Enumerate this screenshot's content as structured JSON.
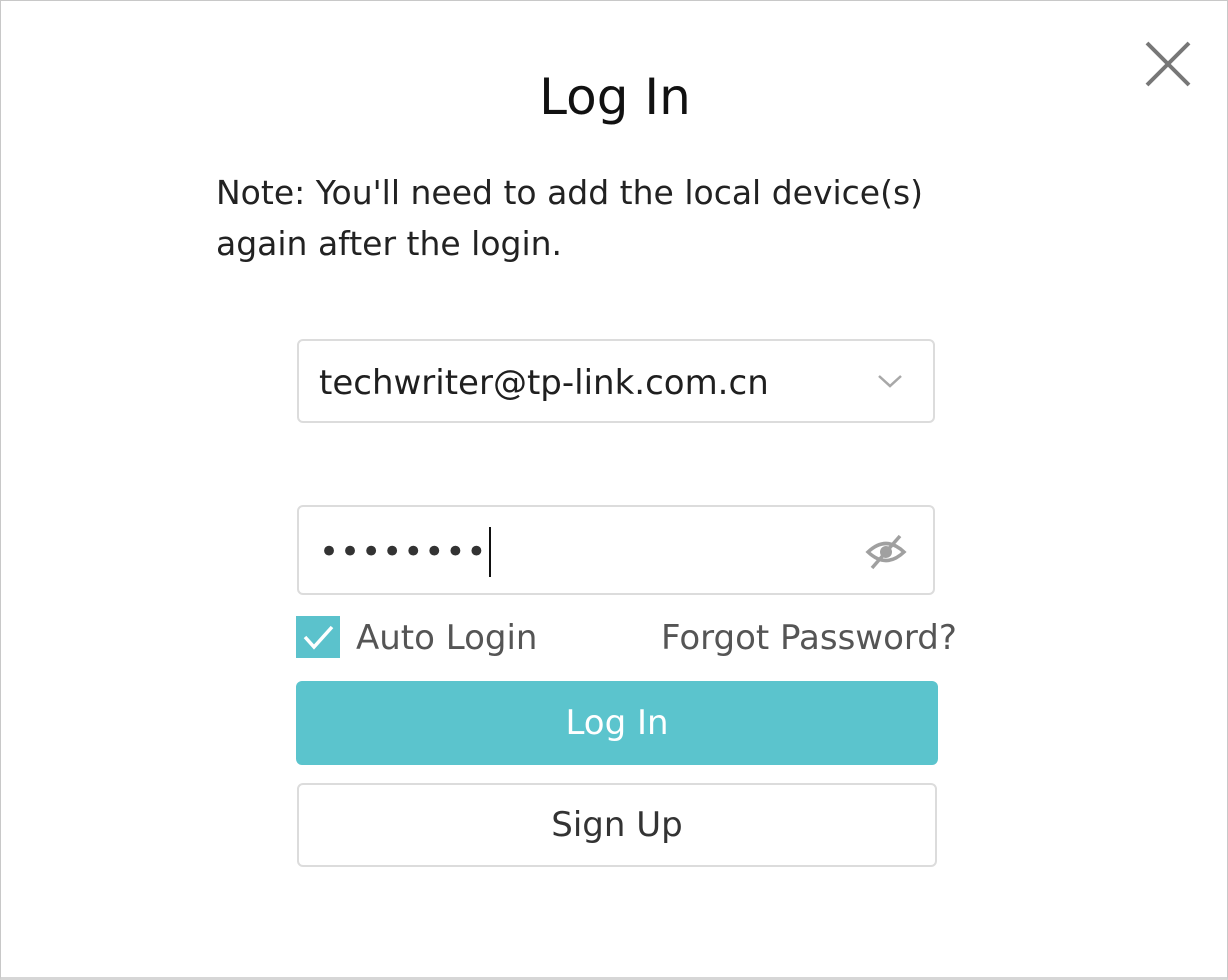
{
  "dialog": {
    "title": "Log In",
    "note": "Note:  You'll need to add the local device(s) again after the login."
  },
  "email": {
    "value": "techwriter@tp-link.com.cn"
  },
  "password": {
    "masked_value": "••••••••"
  },
  "auto_login": {
    "label": "Auto Login",
    "checked": true
  },
  "forgot_password": {
    "label": "Forgot Password?"
  },
  "buttons": {
    "login_label": "Log In",
    "signup_label": "Sign Up"
  },
  "colors": {
    "accent": "#5bc4cd",
    "border": "#dcdcdc",
    "muted_text": "#555555"
  },
  "icons": {
    "close": "close-icon",
    "dropdown": "chevron-down-icon",
    "password_visibility": "eye-off-icon",
    "checkbox": "checkmark-icon"
  }
}
